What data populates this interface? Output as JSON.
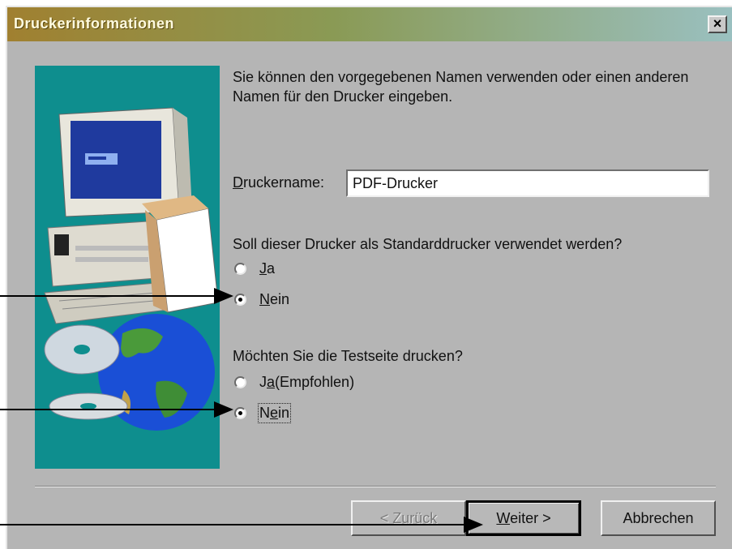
{
  "window": {
    "title": "Druckerinformationen",
    "close_glyph": "×"
  },
  "intro_text": "Sie können den vorgegebenen Namen verwenden oder einen anderen Namen für den Drucker eingeben.",
  "printer_name": {
    "label_underlined": "D",
    "label_rest": "ruckername:",
    "value": "PDF-Drucker"
  },
  "default_printer": {
    "question": "Soll dieser Drucker als Standarddrucker verwendet werden?",
    "options": [
      {
        "underlined": "J",
        "rest": "a",
        "checked": false
      },
      {
        "underlined": "N",
        "rest": "ein",
        "checked": true
      }
    ]
  },
  "test_page": {
    "question": "Möchten Sie die Testseite drucken?",
    "options": [
      {
        "pre": "J",
        "underlined": "a",
        "rest": " (Empfohlen)",
        "checked": false
      },
      {
        "pre": "N",
        "underlined": "e",
        "rest": "in",
        "checked": true
      }
    ]
  },
  "buttons": {
    "back": {
      "pre": "< Z",
      "underlined": "u",
      "rest": "rück",
      "disabled": true
    },
    "next": {
      "underlined": "W",
      "rest": "eiter >"
    },
    "cancel": {
      "label": "Abbrechen"
    }
  },
  "icons": [
    "computer-illustration",
    "printer-box-illustration",
    "globe-illustration",
    "cd-illustration",
    "close-icon"
  ],
  "colors": {
    "dialog_bg": "#b5b5b5",
    "art_bg": "#0e8e8e",
    "title_start": "#a08030",
    "title_end": "#9ac0c0"
  }
}
